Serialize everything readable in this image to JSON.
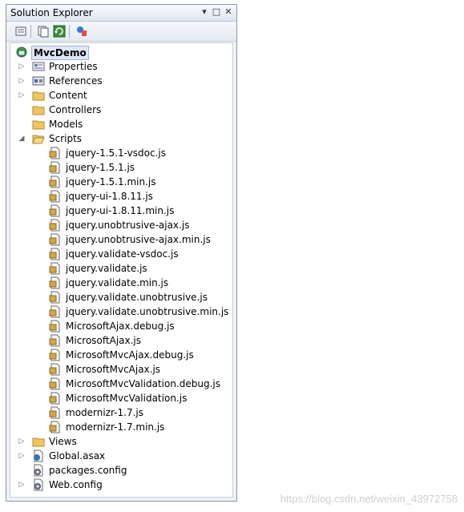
{
  "window": {
    "title": "Solution Explorer",
    "controls": {
      "pin": "▾",
      "maximize": "□",
      "close": "✕"
    }
  },
  "toolbar": {
    "buttons": [
      "properties-icon",
      "show-all-files-icon",
      "refresh-icon",
      "class-diagram-icon"
    ]
  },
  "tree": {
    "project": "MvcDemo",
    "top_items": [
      {
        "label": "Properties",
        "icon": "properties-icon",
        "expander": "collapsed"
      },
      {
        "label": "References",
        "icon": "references-icon",
        "expander": "collapsed"
      },
      {
        "label": "Content",
        "icon": "folder-icon",
        "expander": "collapsed"
      },
      {
        "label": "Controllers",
        "icon": "folder-icon",
        "expander": "none"
      },
      {
        "label": "Models",
        "icon": "folder-icon",
        "expander": "none"
      },
      {
        "label": "Scripts",
        "icon": "folder-open-icon",
        "expander": "expanded"
      }
    ],
    "scripts": [
      "jquery-1.5.1-vsdoc.js",
      "jquery-1.5.1.js",
      "jquery-1.5.1.min.js",
      "jquery-ui-1.8.11.js",
      "jquery-ui-1.8.11.min.js",
      "jquery.unobtrusive-ajax.js",
      "jquery.unobtrusive-ajax.min.js",
      "jquery.validate-vsdoc.js",
      "jquery.validate.js",
      "jquery.validate.min.js",
      "jquery.validate.unobtrusive.js",
      "jquery.validate.unobtrusive.min.js",
      "MicrosoftAjax.debug.js",
      "MicrosoftAjax.js",
      "MicrosoftMvcAjax.debug.js",
      "MicrosoftMvcAjax.js",
      "MicrosoftMvcValidation.debug.js",
      "MicrosoftMvcValidation.js",
      "modernizr-1.7.js",
      "modernizr-1.7.min.js"
    ],
    "bottom_items": [
      {
        "label": "Views",
        "icon": "folder-icon",
        "expander": "collapsed"
      },
      {
        "label": "Global.asax",
        "icon": "asax-file-icon",
        "expander": "collapsed"
      },
      {
        "label": "packages.config",
        "icon": "config-file-icon",
        "expander": "none"
      },
      {
        "label": "Web.config",
        "icon": "config-file-icon",
        "expander": "collapsed"
      }
    ]
  },
  "watermark": "https://blog.csdn.net/weixin_43972758"
}
